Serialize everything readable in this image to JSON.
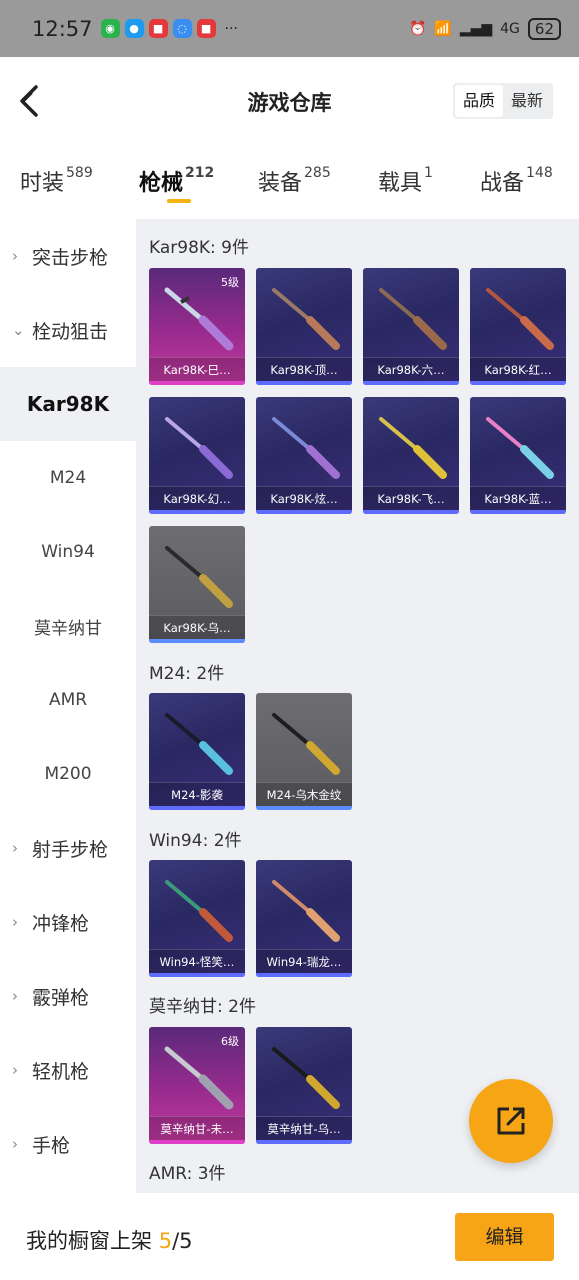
{
  "status_bar": {
    "time": "12:57",
    "apps": [
      {
        "icon": "wechat-icon",
        "color": "#2bb24c",
        "glyph": "◉"
      },
      {
        "icon": "message-icon",
        "color": "#1e9bf0",
        "glyph": "●"
      },
      {
        "icon": "red-app-icon",
        "color": "#e5383b",
        "glyph": "■"
      },
      {
        "icon": "chat-bubble-icon",
        "color": "#3a8ef0",
        "glyph": "◌"
      },
      {
        "icon": "red-app-icon-2",
        "color": "#e5383b",
        "glyph": "■"
      }
    ],
    "more": "···",
    "alarm": "⏰",
    "wifi": "📶",
    "signal": "▂▄▆",
    "network": "4G",
    "battery": "62"
  },
  "header": {
    "title": "游戏仓库",
    "sort_quality": "品质",
    "sort_latest": "最新"
  },
  "tabs": [
    {
      "label": "时装",
      "count": "589"
    },
    {
      "label": "枪械",
      "count": "212"
    },
    {
      "label": "装备",
      "count": "285"
    },
    {
      "label": "载具",
      "count": "1"
    },
    {
      "label": "战备",
      "count": "148"
    }
  ],
  "sidebar": {
    "assault": "突击步枪",
    "bolt": "栓动狙击",
    "kar98k": "Kar98K",
    "m24": "M24",
    "win94": "Win94",
    "mosin": "莫辛纳甘",
    "amr": "AMR",
    "m200": "M200",
    "dmr": "射手步枪",
    "smg": "冲锋枪",
    "shotgun": "霰弹枪",
    "lmg": "轻机枪",
    "pistol": "手枪"
  },
  "sections": {
    "kar98k": {
      "title": "Kar98K: 9件",
      "items": [
        {
          "name": "Kar98K-巳…",
          "level": "5级"
        },
        {
          "name": "Kar98K-顶…"
        },
        {
          "name": "Kar98K-六…"
        },
        {
          "name": "Kar98K-红…"
        },
        {
          "name": "Kar98K-幻…"
        },
        {
          "name": "Kar98K-炫…"
        },
        {
          "name": "Kar98K-飞…"
        },
        {
          "name": "Kar98K-蓝…"
        },
        {
          "name": "Kar98K-乌…"
        }
      ]
    },
    "m24": {
      "title": "M24: 2件",
      "items": [
        {
          "name": "M24-影袭"
        },
        {
          "name": "M24-乌木金纹"
        }
      ]
    },
    "win94": {
      "title": "Win94: 2件",
      "items": [
        {
          "name": "Win94-怪笑…"
        },
        {
          "name": "Win94-瑞龙…"
        }
      ]
    },
    "mosin": {
      "title": "莫辛纳甘: 2件",
      "items": [
        {
          "name": "莫辛纳甘-未…",
          "level": "6级"
        },
        {
          "name": "莫辛纳甘-乌…"
        }
      ]
    },
    "amr": {
      "title": "AMR: 3件"
    }
  },
  "bottom_bar": {
    "shelf_label": "我的橱窗上架",
    "shelf_used": "5",
    "shelf_sep": "/",
    "shelf_total": "5",
    "edit_label": "编辑"
  },
  "colors": {
    "accent": "#f6a515",
    "content_bg": "#eef0f3",
    "card_blue": "#2a2862",
    "card_gold": "#9a2b8e",
    "card_grey": "#5a5a5f"
  }
}
